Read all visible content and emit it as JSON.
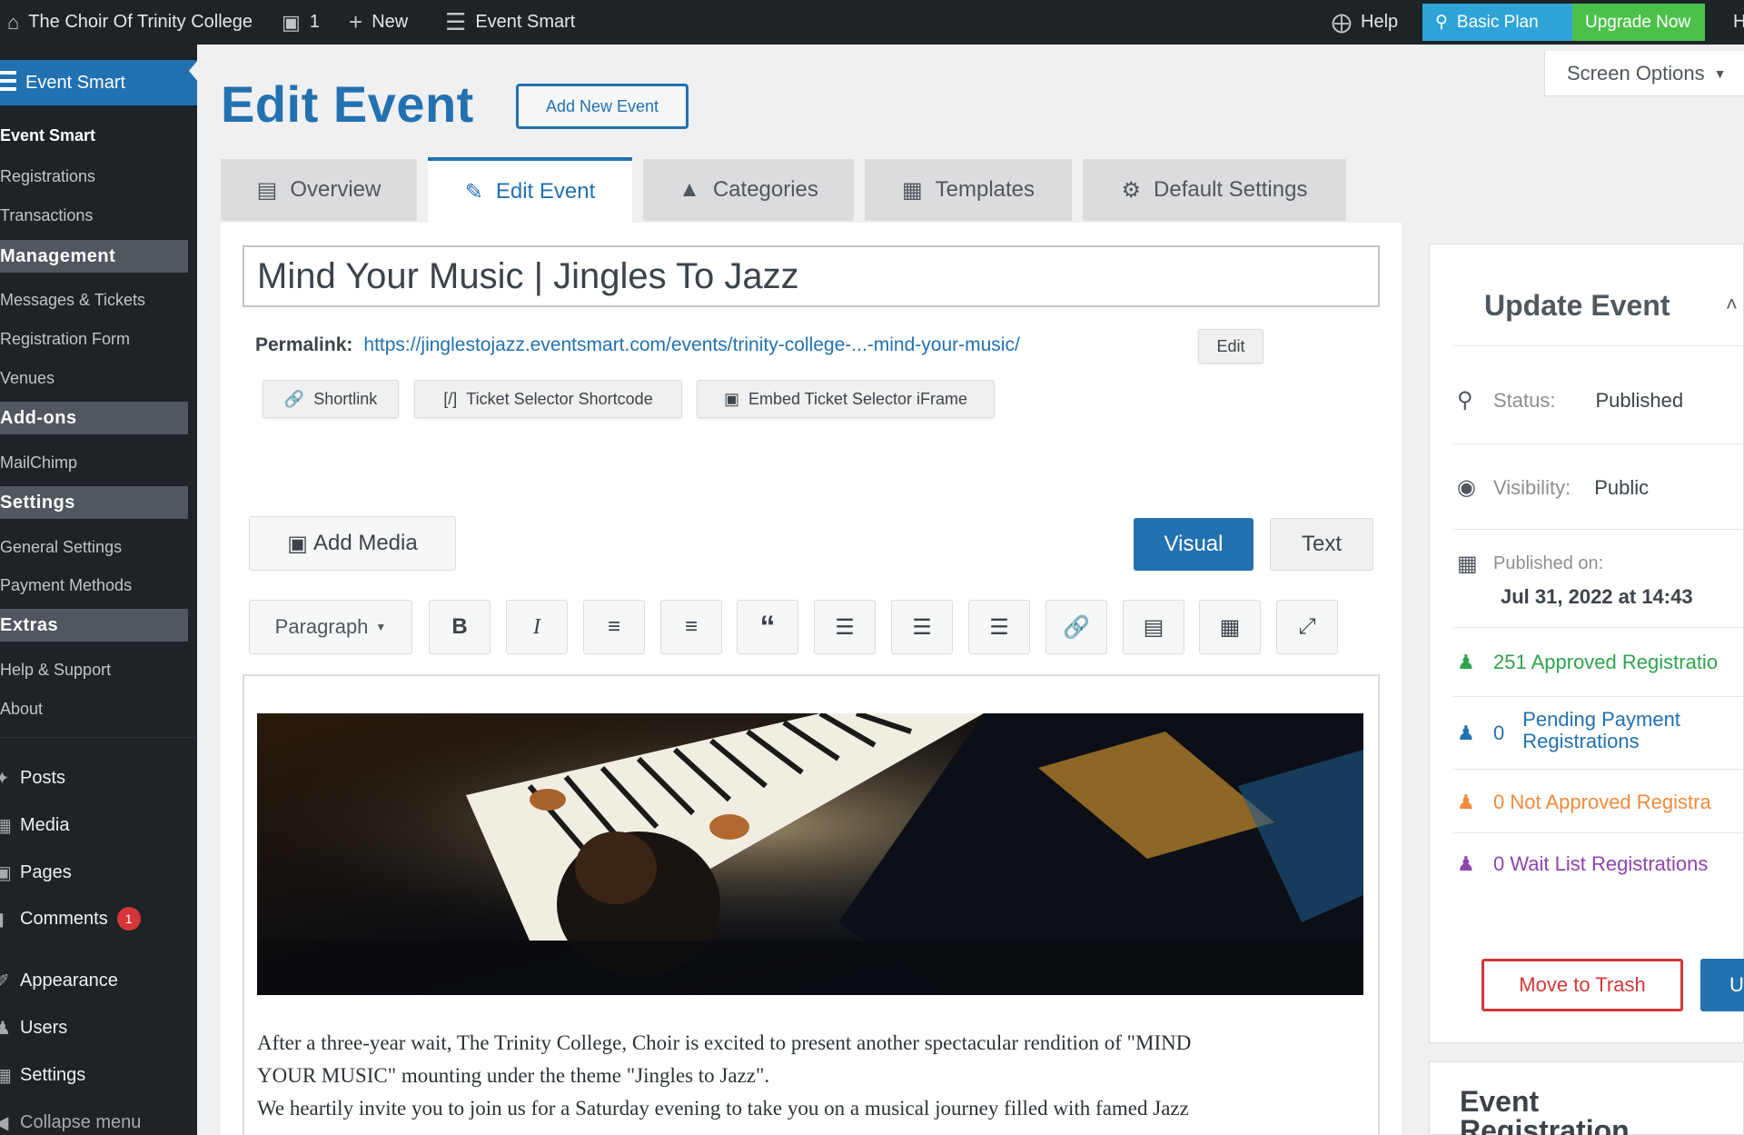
{
  "admin_bar": {
    "site_name": "The Choir Of Trinity College",
    "comments_count": "1",
    "new_label": "New",
    "plugin_label": "Event Smart",
    "help_label": "Help",
    "plan_label": "Basic Plan",
    "upgrade_label": "Upgrade Now",
    "right_cut_label": "H"
  },
  "sidebar": {
    "active_label": "Event Smart",
    "submenu": [
      "Event Smart",
      "Registrations",
      "Transactions"
    ],
    "management_head": "Management",
    "management_items": [
      "Messages & Tickets",
      "Registration Form",
      "Venues"
    ],
    "addons_head": "Add-ons",
    "addons_items": [
      "MailChimp"
    ],
    "settings_head": "Settings",
    "settings_items": [
      "General Settings",
      "Payment Methods"
    ],
    "extras_head": "Extras",
    "extras_items": [
      "Help & Support",
      "About"
    ],
    "main_items": [
      {
        "label": "Posts",
        "icon": "pin-icon"
      },
      {
        "label": "Media",
        "icon": "media-icon"
      },
      {
        "label": "Pages",
        "icon": "pages-icon"
      },
      {
        "label": "Comments",
        "icon": "comments-icon",
        "badge": "1"
      },
      {
        "label": "Appearance",
        "icon": "brush-icon"
      },
      {
        "label": "Users",
        "icon": "users-icon"
      },
      {
        "label": "Settings",
        "icon": "settings-icon"
      },
      {
        "label": "Collapse menu",
        "icon": "collapse-icon"
      }
    ]
  },
  "page": {
    "title": "Edit Event",
    "add_new_label": "Add New Event",
    "screen_options_label": "Screen Options"
  },
  "tabs": [
    {
      "label": "Overview",
      "icon": "list-icon"
    },
    {
      "label": "Edit Event",
      "icon": "pencil-icon",
      "active": true
    },
    {
      "label": "Categories",
      "icon": "sitemap-icon"
    },
    {
      "label": "Templates",
      "icon": "template-icon"
    },
    {
      "label": "Default Settings",
      "icon": "gear-icon"
    }
  ],
  "event": {
    "title": "Mind Your Music | Jingles To Jazz",
    "permalink_label": "Permalink:",
    "permalink_url": "https://jinglestojazz.eventsmart.com/events/trinity-college-...-mind-your-music/",
    "edit_label": "Edit",
    "shortlink_label": "Shortlink",
    "ticket_shortcode_label": "Ticket Selector Shortcode",
    "embed_iframe_label": "Embed Ticket Selector iFrame"
  },
  "editor": {
    "add_media_label": "Add Media",
    "visual_label": "Visual",
    "text_label": "Text",
    "paragraph_label": "Paragraph",
    "body_lines": [
      "After a three-year wait, The Trinity College, Choir is excited to present another spectacular rendition of  \"MIND",
      "YOUR MUSIC\" mounting under the theme \"Jingles to Jazz\".",
      "We heartily invite you to join us for a Saturday evening to take you on a musical journey filled with famed Jazz"
    ]
  },
  "update_panel": {
    "title": "Update Event",
    "status_label": "Status:",
    "status_value": "Published",
    "visibility_label": "Visibility:",
    "visibility_value": "Public",
    "published_label": "Published on:",
    "published_value": "Jul 31, 2022 at 14:43",
    "approved": "251 Approved Registratio",
    "pending_count": "0",
    "pending_label_1": "Pending Payment",
    "pending_label_2": "Registrations",
    "not_approved": "0 Not Approved Registra",
    "wait_list": "0 Wait List Registrations",
    "trash_label": "Move to Trash",
    "update_label": "U",
    "colors": {
      "approved": "#2ea44f",
      "pending": "#2271b1",
      "not_approved": "#f08a3c",
      "wait_list": "#8e44ad"
    }
  },
  "event_reg_panel": {
    "title_1": "Event",
    "title_2": "Registration"
  }
}
